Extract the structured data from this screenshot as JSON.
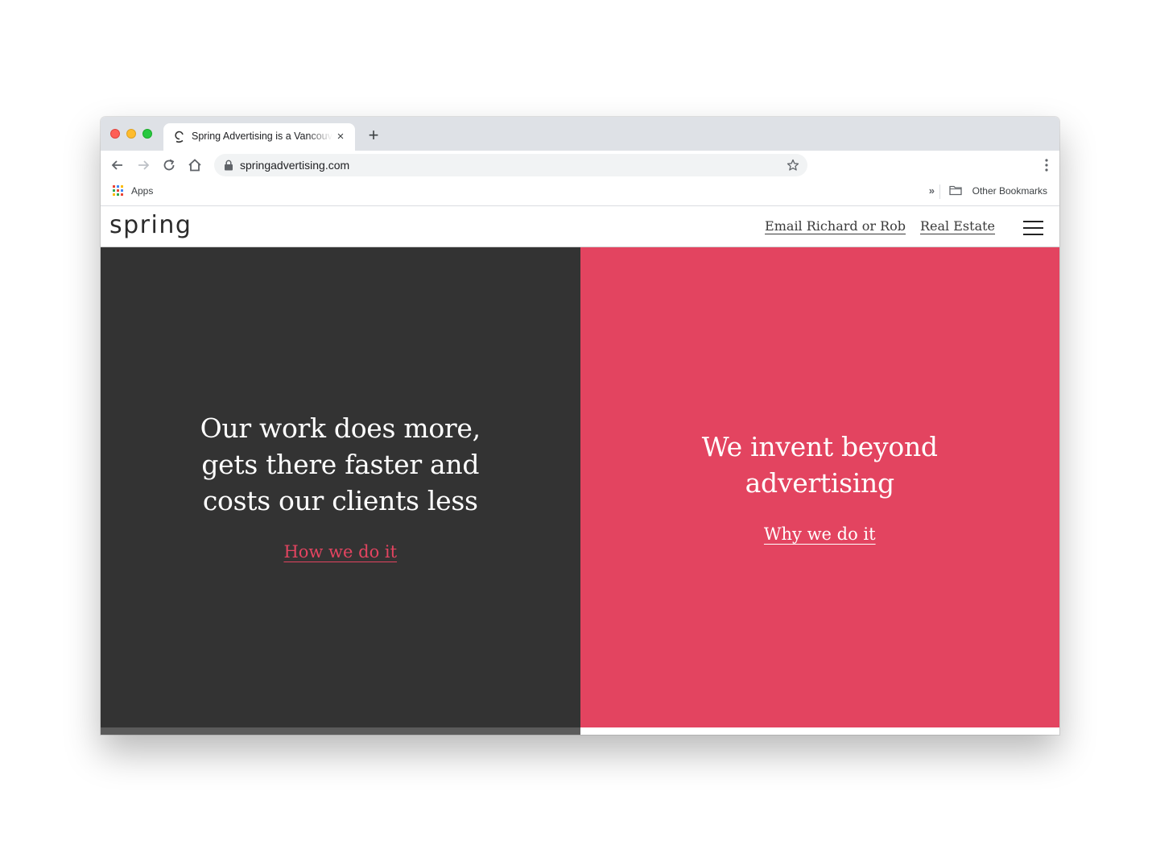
{
  "browser": {
    "tab_title": "Spring Advertising is a Vancouver advertising agency",
    "tab_close": "×",
    "new_tab": "+",
    "url": "springadvertising.com",
    "bookmarks": {
      "apps_label": "Apps",
      "overflow": "»",
      "other_bookmarks": "Other Bookmarks"
    }
  },
  "site": {
    "logo": "spring",
    "nav": {
      "email": "Email Richard or Rob",
      "real_estate": "Real Estate"
    },
    "left_panel": {
      "headline_line1": "Our work does more,",
      "headline_line2": "gets there faster and",
      "headline_line3": "costs our clients less",
      "link": "How we do it",
      "bg_color": "#333333",
      "link_color": "#e34460"
    },
    "right_panel": {
      "headline_line1": "We invent beyond",
      "headline_line2": "advertising",
      "link": "Why we do it",
      "bg_color": "#e34460",
      "link_color": "#ffffff"
    }
  }
}
